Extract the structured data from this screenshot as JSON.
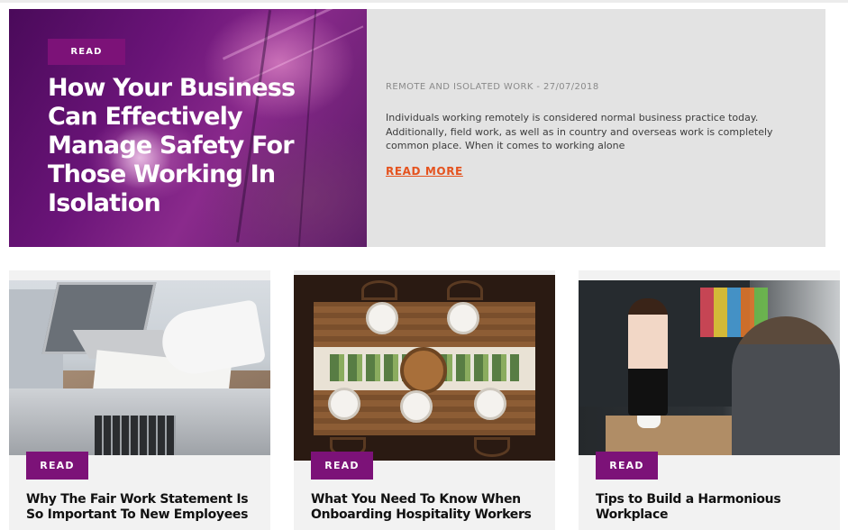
{
  "hero": {
    "badge": "READ",
    "title": "How Your Business Can Effectively Manage Safety For Those Working In Isolation",
    "meta": "REMOTE AND ISOLATED WORK - 27/07/2018",
    "description": "Individuals working remotely is considered normal business practice today. Additionally, field work, as well as in country and overseas work is completely common place. When it comes to working alone",
    "link": "READ MORE"
  },
  "cards": [
    {
      "badge": "READ",
      "title": "Why The Fair Work Statement Is So Important To New Employees"
    },
    {
      "badge": "READ",
      "title": "What You Need To Know When Onboarding Hospitality Workers"
    },
    {
      "badge": "READ",
      "title": "Tips to Build a Harmonious Workplace"
    }
  ],
  "colors": {
    "badge_bg": "#7c1278",
    "link": "#e5531f",
    "hero_panel": "#e3e3e3",
    "card_bg": "#f2f2f2"
  }
}
